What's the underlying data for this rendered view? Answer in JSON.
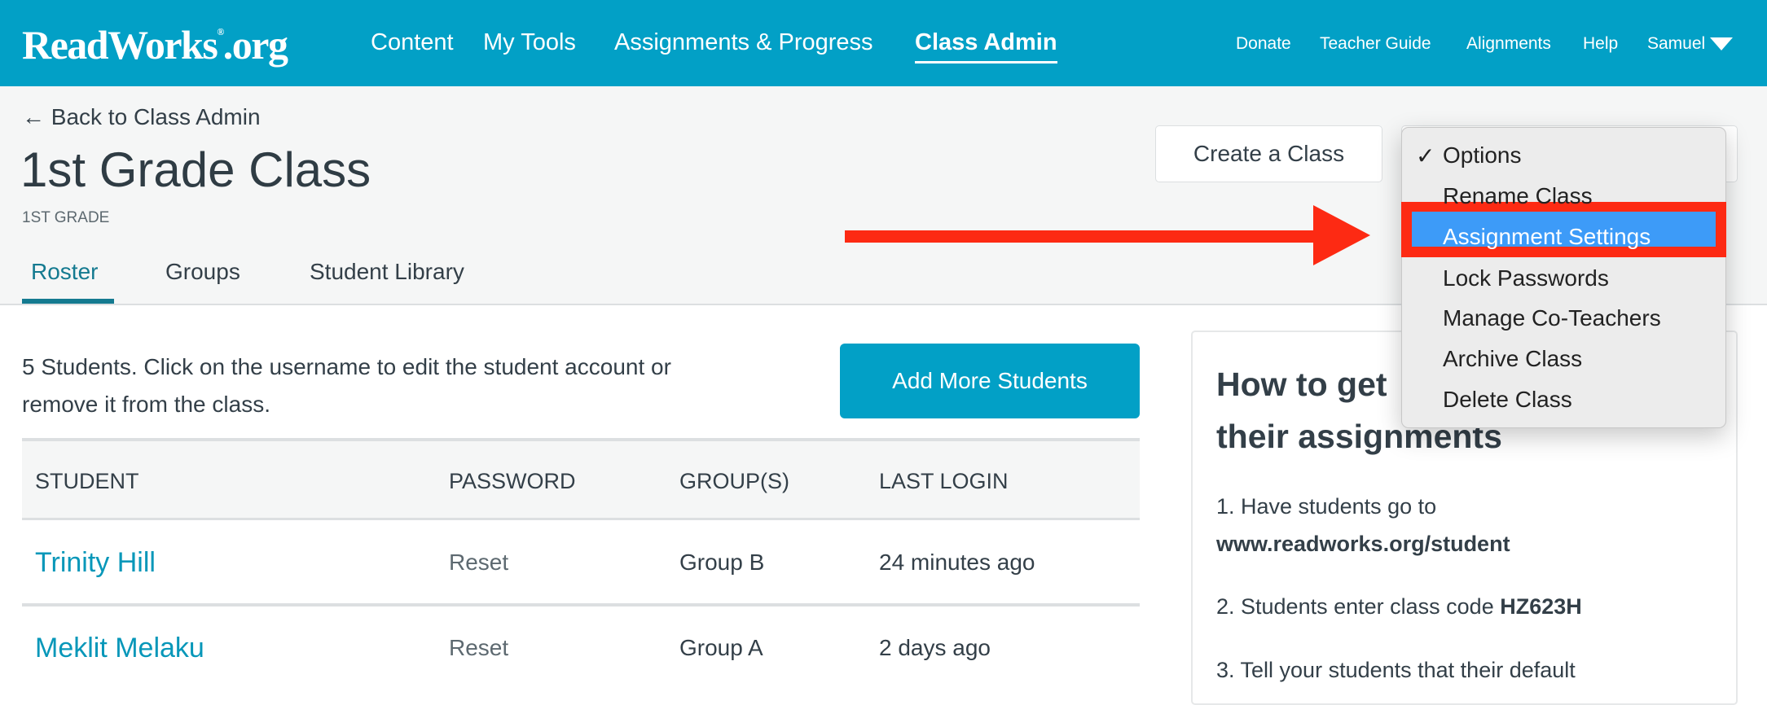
{
  "header": {
    "logo": "ReadWorks.org",
    "logo_main": "ReadWorks",
    "logo_reg": "®",
    "logo_tld": ".org",
    "nav": [
      "Content",
      "My Tools",
      "Assignments & Progress",
      "Class Admin"
    ],
    "right_nav": [
      "Donate",
      "Teacher Guide",
      "Alignments",
      "Help",
      "Samuel"
    ]
  },
  "page": {
    "back": "← Back to Class Admin",
    "title": "1st Grade Class",
    "grade": "1ST GRADE",
    "tabs": [
      "Roster",
      "Groups",
      "Student Library"
    ],
    "create_button": "Create a Class"
  },
  "roster": {
    "intro_line1": "5 Students. Click on the username to edit the student account or",
    "intro_line2": "remove it from the class.",
    "add_button": "Add More Students",
    "columns": [
      "STUDENT",
      "PASSWORD",
      "GROUP(S)",
      "LAST LOGIN"
    ],
    "rows": [
      {
        "student": "Trinity Hill",
        "password": "Reset",
        "group": "Group B",
        "last_login": "24 minutes ago"
      },
      {
        "student": "Meklit Melaku",
        "password": "Reset",
        "group": "Group A",
        "last_login": "2 days ago"
      }
    ]
  },
  "card": {
    "heading_line1": "How to get",
    "heading_line2": "their assignments",
    "step1": "1. Have students go to",
    "step1_url": "www.readworks.org/student",
    "step2": "2. Students enter class code ",
    "step2_code": "HZ623H",
    "step3": "3. Tell your students that their default"
  },
  "dropdown": {
    "check": "✓",
    "items": [
      "Options",
      "Rename Class",
      "Assignment Settings",
      "Lock Passwords",
      "Manage Co-Teachers",
      "Archive Class",
      "Delete Class"
    ],
    "highlighted": "Assignment Settings"
  },
  "colors": {
    "brand": "#02a0c6",
    "annotation": "#fd2a13",
    "highlight": "#3d9bf8"
  }
}
